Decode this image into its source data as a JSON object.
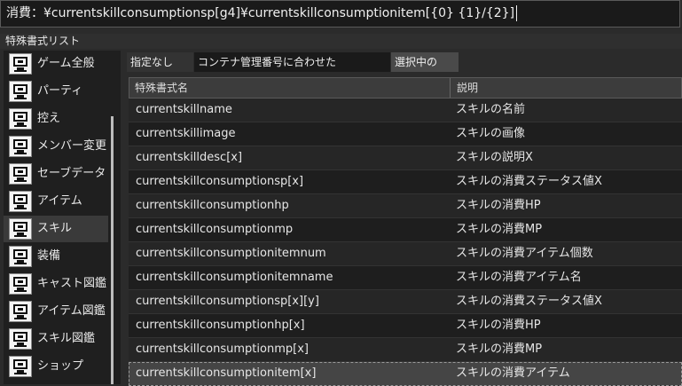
{
  "format_input": {
    "value": "消費：¥currentskillconsumptionsp[g4]¥currentskillconsumptionitem[{0} {1}/{2}]"
  },
  "section_title": "特殊書式リスト",
  "sidebar": {
    "items": [
      {
        "label": "ゲーム全般",
        "icon": "monitor-icon"
      },
      {
        "label": "パーティ",
        "icon": "monitor-icon"
      },
      {
        "label": "控え",
        "icon": "monitor-icon"
      },
      {
        "label": "メンバー変更",
        "icon": "monitor-icon"
      },
      {
        "label": "セーブデータ",
        "icon": "monitor-icon"
      },
      {
        "label": "アイテム",
        "icon": "monitor-icon"
      },
      {
        "label": "スキル",
        "icon": "monitor-icon",
        "selected": true
      },
      {
        "label": "装備",
        "icon": "monitor-icon"
      },
      {
        "label": "キャスト図鑑",
        "icon": "monitor-icon"
      },
      {
        "label": "アイテム図鑑",
        "icon": "monitor-icon"
      },
      {
        "label": "スキル図鑑",
        "icon": "monitor-icon"
      },
      {
        "label": "ショップ",
        "icon": "monitor-icon"
      }
    ]
  },
  "tabs": [
    "指定なし",
    "コンテナ管理番号に合わせた",
    "選択中の"
  ],
  "table": {
    "headers": [
      "特殊書式名",
      "説明"
    ],
    "rows": [
      [
        "currentskillname",
        "スキルの名前"
      ],
      [
        "currentskillimage",
        "スキルの画像"
      ],
      [
        "currentskilldesc[x]",
        "スキルの説明X"
      ],
      [
        "currentskillconsumptionsp[x]",
        "スキルの消費ステータス値X"
      ],
      [
        "currentskillconsumptionhp",
        "スキルの消費HP"
      ],
      [
        "currentskillconsumptionmp",
        "スキルの消費MP"
      ],
      [
        "currentskillconsumptionitemnum",
        "スキルの消費アイテム個数"
      ],
      [
        "currentskillconsumptionitemname",
        "スキルの消費アイテム名"
      ],
      [
        "currentskillconsumptionsp[x][y]",
        "スキルの消費ステータス値X"
      ],
      [
        "currentskillconsumptionhp[x]",
        "スキルの消費HP"
      ],
      [
        "currentskillconsumptionmp[x]",
        "スキルの消費MP"
      ],
      [
        "currentskillconsumptionitem[x]",
        "スキルの消費アイテム"
      ]
    ],
    "selected_row": 11
  }
}
